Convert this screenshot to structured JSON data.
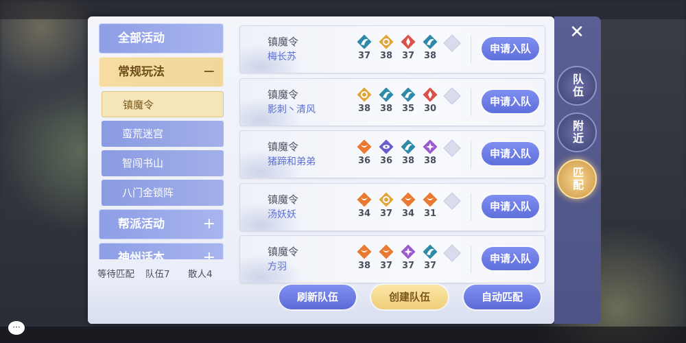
{
  "sidebar": {
    "categories": [
      {
        "label": "全部活动",
        "sign": ""
      },
      {
        "label": "常规玩法",
        "sign": "−"
      },
      {
        "label": "帮派活动",
        "sign": "+"
      },
      {
        "label": "神州话本",
        "sign": "+"
      }
    ],
    "subitems": [
      "镇魔令",
      "蛮荒迷宫",
      "智闯书山",
      "八门金锁阵"
    ]
  },
  "status": {
    "waiting": "等待匹配",
    "teams": "队伍7",
    "solo": "散人4"
  },
  "teams": [
    {
      "title": "镇魔令",
      "names": "梅长苏",
      "members": [
        {
          "icon": "teal-crescent",
          "level": "37"
        },
        {
          "icon": "gold-swirl",
          "level": "38"
        },
        {
          "icon": "red-lotus",
          "level": "37"
        },
        {
          "icon": "teal-crescent",
          "level": "38"
        }
      ],
      "apply_label": "申请入队"
    },
    {
      "title": "镇魔令",
      "names": "影刺丶清风",
      "members": [
        {
          "icon": "gold-swirl",
          "level": "38"
        },
        {
          "icon": "teal-crescent",
          "level": "38"
        },
        {
          "icon": "teal-crescent",
          "level": "35"
        },
        {
          "icon": "red-lotus",
          "level": "30"
        }
      ],
      "apply_label": "申请入队"
    },
    {
      "title": "镇魔令",
      "names": "猪蹄和弟弟",
      "members": [
        {
          "icon": "orange-phoenix",
          "level": "36"
        },
        {
          "icon": "purple-eye",
          "level": "36"
        },
        {
          "icon": "teal-crescent",
          "level": "38"
        },
        {
          "icon": "purple-flower",
          "level": "38"
        }
      ],
      "apply_label": "申请入队"
    },
    {
      "title": "镇魔令",
      "names": "汤妖妖",
      "members": [
        {
          "icon": "orange-phoenix",
          "level": "34"
        },
        {
          "icon": "gold-swirl",
          "level": "37"
        },
        {
          "icon": "orange-phoenix",
          "level": "34"
        },
        {
          "icon": "orange-phoenix",
          "level": "31"
        }
      ],
      "apply_label": "申请入队"
    },
    {
      "title": "镇魔令",
      "names": "方羽",
      "members": [
        {
          "icon": "orange-phoenix",
          "level": "38"
        },
        {
          "icon": "orange-phoenix",
          "level": "37"
        },
        {
          "icon": "purple-flower",
          "level": "37"
        },
        {
          "icon": "teal-crescent",
          "level": "37"
        }
      ],
      "apply_label": "申请入队"
    }
  ],
  "bottom": {
    "refresh": "刷新队伍",
    "create": "创建队伍",
    "auto": "自动匹配"
  },
  "side_tabs": [
    "队伍",
    "附近",
    "匹配"
  ],
  "colors": {
    "teal-crescent": "#2f8aa8",
    "gold-swirl": "#e0a43a",
    "red-lotus": "#d9534a",
    "orange-phoenix": "#ea7a33",
    "purple-eye": "#6a5ccc",
    "purple-flower": "#9b5acd"
  }
}
